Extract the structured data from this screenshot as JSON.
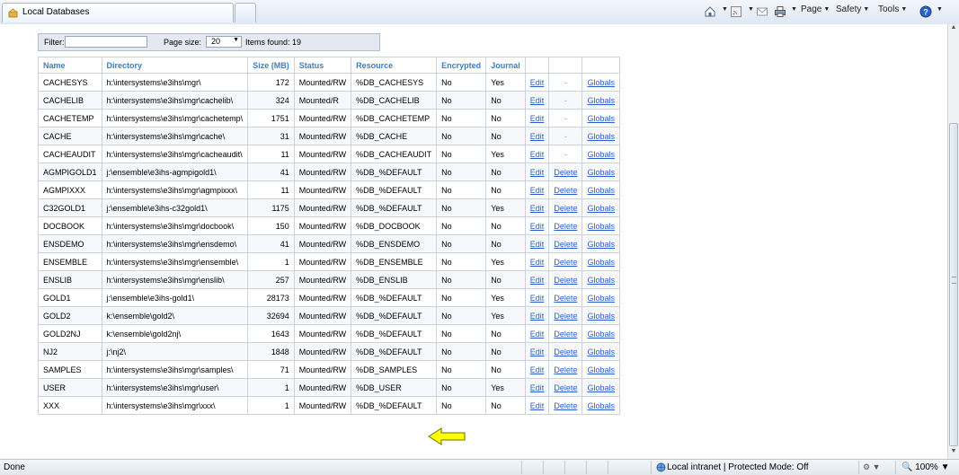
{
  "tab": {
    "title": "Local Databases"
  },
  "toolbar": {
    "page_label": "Page",
    "safety_label": "Safety",
    "tools_label": "Tools",
    "help_label": "?"
  },
  "filter": {
    "filter_label": "Filter:",
    "filter_value": "",
    "page_size_label": "Page size:",
    "page_size_value": "20",
    "items_found": "Items found: 19"
  },
  "table": {
    "headers": [
      "Name",
      "Directory",
      "Size (MB)",
      "Status",
      "Resource",
      "Encrypted",
      "Journal",
      "",
      "",
      ""
    ],
    "rows": [
      {
        "name": "CACHESYS",
        "directory": "h:\\intersystems\\e3ihs\\mgr\\",
        "size": "172",
        "status": "Mounted/RW",
        "resource": "%DB_CACHESYS",
        "encrypted": "No",
        "journal": "Yes",
        "edit": "Edit",
        "delete": "-",
        "globals": "Globals"
      },
      {
        "name": "CACHELIB",
        "directory": "h:\\intersystems\\e3ihs\\mgr\\cachelib\\",
        "size": "324",
        "status": "Mounted/R",
        "resource": "%DB_CACHELIB",
        "encrypted": "No",
        "journal": "No",
        "edit": "Edit",
        "delete": "-",
        "globals": "Globals"
      },
      {
        "name": "CACHETEMP",
        "directory": "h:\\intersystems\\e3ihs\\mgr\\cachetemp\\",
        "size": "1751",
        "status": "Mounted/RW",
        "resource": "%DB_CACHETEMP",
        "encrypted": "No",
        "journal": "No",
        "edit": "Edit",
        "delete": "-",
        "globals": "Globals"
      },
      {
        "name": "CACHE",
        "directory": "h:\\intersystems\\e3ihs\\mgr\\cache\\",
        "size": "31",
        "status": "Mounted/RW",
        "resource": "%DB_CACHE",
        "encrypted": "No",
        "journal": "No",
        "edit": "Edit",
        "delete": "-",
        "globals": "Globals"
      },
      {
        "name": "CACHEAUDIT",
        "directory": "h:\\intersystems\\e3ihs\\mgr\\cacheaudit\\",
        "size": "11",
        "status": "Mounted/RW",
        "resource": "%DB_CACHEAUDIT",
        "encrypted": "No",
        "journal": "Yes",
        "edit": "Edit",
        "delete": "-",
        "globals": "Globals"
      },
      {
        "name": "AGMPIGOLD1",
        "directory": "j:\\ensemble\\e3ihs-agmpigold1\\",
        "size": "41",
        "status": "Mounted/RW",
        "resource": "%DB_%DEFAULT",
        "encrypted": "No",
        "journal": "No",
        "edit": "Edit",
        "delete": "Delete",
        "globals": "Globals"
      },
      {
        "name": "AGMPIXXX",
        "directory": "h:\\intersystems\\e3ihs\\mgr\\agmpixxx\\",
        "size": "11",
        "status": "Mounted/RW",
        "resource": "%DB_%DEFAULT",
        "encrypted": "No",
        "journal": "No",
        "edit": "Edit",
        "delete": "Delete",
        "globals": "Globals"
      },
      {
        "name": "C32GOLD1",
        "directory": "j:\\ensemble\\e3ihs-c32gold1\\",
        "size": "1175",
        "status": "Mounted/RW",
        "resource": "%DB_%DEFAULT",
        "encrypted": "No",
        "journal": "Yes",
        "edit": "Edit",
        "delete": "Delete",
        "globals": "Globals"
      },
      {
        "name": "DOCBOOK",
        "directory": "h:\\intersystems\\e3ihs\\mgr\\docbook\\",
        "size": "150",
        "status": "Mounted/RW",
        "resource": "%DB_DOCBOOK",
        "encrypted": "No",
        "journal": "No",
        "edit": "Edit",
        "delete": "Delete",
        "globals": "Globals"
      },
      {
        "name": "ENSDEMO",
        "directory": "h:\\intersystems\\e3ihs\\mgr\\ensdemo\\",
        "size": "41",
        "status": "Mounted/RW",
        "resource": "%DB_ENSDEMO",
        "encrypted": "No",
        "journal": "No",
        "edit": "Edit",
        "delete": "Delete",
        "globals": "Globals"
      },
      {
        "name": "ENSEMBLE",
        "directory": "h:\\intersystems\\e3ihs\\mgr\\ensemble\\",
        "size": "1",
        "status": "Mounted/RW",
        "resource": "%DB_ENSEMBLE",
        "encrypted": "No",
        "journal": "Yes",
        "edit": "Edit",
        "delete": "Delete",
        "globals": "Globals"
      },
      {
        "name": "ENSLIB",
        "directory": "h:\\intersystems\\e3ihs\\mgr\\enslib\\",
        "size": "257",
        "status": "Mounted/RW",
        "resource": "%DB_ENSLIB",
        "encrypted": "No",
        "journal": "No",
        "edit": "Edit",
        "delete": "Delete",
        "globals": "Globals"
      },
      {
        "name": "GOLD1",
        "directory": "j:\\ensemble\\e3ihs-gold1\\",
        "size": "28173",
        "status": "Mounted/RW",
        "resource": "%DB_%DEFAULT",
        "encrypted": "No",
        "journal": "Yes",
        "edit": "Edit",
        "delete": "Delete",
        "globals": "Globals"
      },
      {
        "name": "GOLD2",
        "directory": "k:\\ensemble\\gold2\\",
        "size": "32694",
        "status": "Mounted/RW",
        "resource": "%DB_%DEFAULT",
        "encrypted": "No",
        "journal": "Yes",
        "edit": "Edit",
        "delete": "Delete",
        "globals": "Globals"
      },
      {
        "name": "GOLD2NJ",
        "directory": "k:\\ensemble\\gold2nj\\",
        "size": "1643",
        "status": "Mounted/RW",
        "resource": "%DB_%DEFAULT",
        "encrypted": "No",
        "journal": "No",
        "edit": "Edit",
        "delete": "Delete",
        "globals": "Globals"
      },
      {
        "name": "NJ2",
        "directory": "j:\\nj2\\",
        "size": "1848",
        "status": "Mounted/RW",
        "resource": "%DB_%DEFAULT",
        "encrypted": "No",
        "journal": "No",
        "edit": "Edit",
        "delete": "Delete",
        "globals": "Globals"
      },
      {
        "name": "SAMPLES",
        "directory": "h:\\intersystems\\e3ihs\\mgr\\samples\\",
        "size": "71",
        "status": "Mounted/RW",
        "resource": "%DB_SAMPLES",
        "encrypted": "No",
        "journal": "No",
        "edit": "Edit",
        "delete": "Delete",
        "globals": "Globals"
      },
      {
        "name": "USER",
        "directory": "h:\\intersystems\\e3ihs\\mgr\\user\\",
        "size": "1",
        "status": "Mounted/RW",
        "resource": "%DB_USER",
        "encrypted": "No",
        "journal": "Yes",
        "edit": "Edit",
        "delete": "Delete",
        "globals": "Globals"
      },
      {
        "name": "XXX",
        "directory": "h:\\intersystems\\e3ihs\\mgr\\xxx\\",
        "size": "1",
        "status": "Mounted/RW",
        "resource": "%DB_%DEFAULT",
        "encrypted": "No",
        "journal": "No",
        "edit": "Edit",
        "delete": "Delete",
        "globals": "Globals"
      }
    ]
  },
  "statusbar": {
    "status": "Done",
    "zone": "Local intranet | Protected Mode: Off",
    "zoom": "100%"
  },
  "colors": {
    "header_text": "#3d7dc4",
    "link": "#2d5ed0",
    "arrow_fill": "#ffff00"
  },
  "icons": [
    "tab-page-icon",
    "home-icon",
    "feeds-icon",
    "read-mail-icon",
    "print-icon",
    "help-icon",
    "zone-globe-icon",
    "annotation-arrow"
  ]
}
